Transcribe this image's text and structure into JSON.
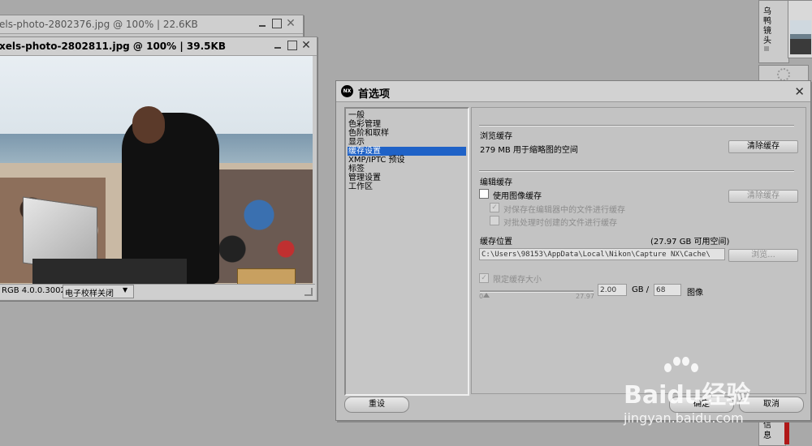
{
  "back_window": {
    "title": "els-photo-2802376.jpg @ 100% | 22.6KB"
  },
  "front_window": {
    "title": "xels-photo-2802811.jpg @ 100% | 39.5KB",
    "status_profile": "RGB 4.0.0.3002",
    "status_proof": "电子校样关闭",
    "status_proof_arrow": "▼"
  },
  "right_panel": {
    "label_chars": [
      "乌",
      "鸭",
      "镜",
      "头"
    ],
    "bottom_chars": [
      "信",
      "息"
    ]
  },
  "dialog": {
    "title": "首选项",
    "logo": "NX",
    "close": "✕",
    "categories": [
      {
        "label": "一般",
        "selected": false
      },
      {
        "label": "色彩管理",
        "selected": false
      },
      {
        "label": "色阶和取样",
        "selected": false
      },
      {
        "label": "显示",
        "selected": false
      },
      {
        "label": "缓存设置",
        "selected": true
      },
      {
        "label": "XMP/IPTC 预设",
        "selected": false
      },
      {
        "label": "标签",
        "selected": false
      },
      {
        "label": "管理设置",
        "selected": false
      },
      {
        "label": "工作区",
        "selected": false
      }
    ],
    "browse_cache": {
      "heading": "浏览缓存",
      "usage_text": "279 MB 用于缩略图的空间",
      "clear_button": "清除缓存"
    },
    "edit_cache": {
      "heading": "编辑缓存",
      "use_image_cache": "使用图像缓存",
      "clear_button": "清除缓存",
      "cache_saved_in_editor": "对保存在编辑器中的文件进行缓存",
      "cache_batch_files": "对批处理时创建的文件进行缓存",
      "location_label": "缓存位置",
      "free_space": "(27.97 GB 可用空间)",
      "path": "C:\\Users\\98153\\AppData\\Local\\Nikon\\Capture NX\\Cache\\",
      "browse_button": "浏览...",
      "limit_size": "限定缓存大小",
      "check_mark": "✓",
      "slider_min": "0",
      "slider_max": "27.97",
      "slider_fraction": 0.0,
      "size_value": "2.00",
      "size_unit": "GB /",
      "image_count": "68",
      "image_unit": "图像"
    },
    "reset_button": "重设",
    "ok_button": "确定",
    "cancel_button": "取消"
  },
  "watermark": {
    "brand": "Baidu经验",
    "url": "jingyan.baidu.com"
  }
}
